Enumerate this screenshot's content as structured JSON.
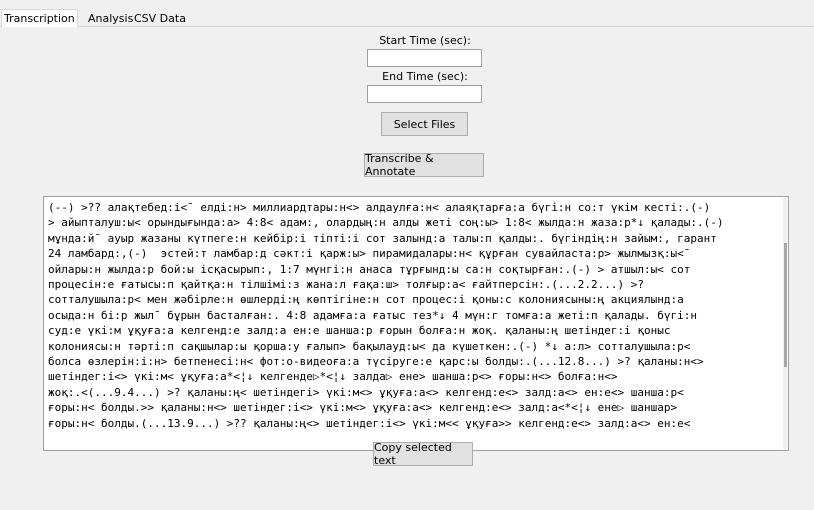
{
  "tabs": [
    {
      "label": "Transcription"
    },
    {
      "label": "Analysis"
    },
    {
      "label": "CSV Data"
    }
  ],
  "form": {
    "start_label": "Start Time (sec):",
    "start_value": "",
    "end_label": "End Time (sec):",
    "end_value": "",
    "select_files_label": "Select Files",
    "transcribe_label": "Transcribe & Annotate"
  },
  "transcript": {
    "lines": [
      "(--) >?? алақтебед:і<¯ елді:н> миллиардтары:н<> алдаулға:н< алаяқтарға:а бүгі:н со:т үкім кесті:.(-)",
      "> айыпталуш:ы< орындығында:а> 4:8< адам:, олардың:н алды жеті соң:ы> 1:8< жылда:н жаза:р*↓ қалады:.(-)",
      "мұнда:й¯ ауыр жазаны күтпеге:н кейбір:і тіпті:і сот залынд:а талы:п қалды:. бүгіндің:н зайым:, гарант",
      "24 ламбард:,(-)  эстей:т ламбар:д сәкт:і қарж:ы> пирамидалары:н< құрған сувайласта:р> жылмызқ:ы<¯",
      "ойлары:н жылда:р бой:ы ісқасырып:, 1:7 мүнгі:н анаса тұрғынд:ы са:н соқтырған:.(-) > атшыл:ы< сот",
      "процесін:е ғатысы:п қайтқа:н тілшімі:з жана:л ғақа:ш> толғыр:а< ғайтперсін:.(...2.2...) >?",
      "сотталушыла:р< мен жәбірле:н өшлерді:ң көптігіне:н сот процес:і қоны:с колониясыны:ң акциялынд:а",
      "осыда:н бі:р жыл¯ бұрын басталған:. 4:8 адамға:а ғатыс тез*↓ 4 мүн:г томға:а жеті:п қалады. бүгі:н",
      "суд:е үкі:м ұқуға:а келгенд:е залд:а ен:е шанша:р ғорын болға:н жоқ. қаланы:ң шетіндег:і қоныс",
      "колониясы:н тәрті:п сақшылар:ы қорша:у ғалып> бақылауд:ы< да күшеткен:.(-) *↓ а:л> сотталушыла:р<",
      "болса өзлерін:і:н> бетпенесі:н< фот:о-видеоға:а түсіруге:е қарс:ы болды:.(...12.8...) >? қаланы:н<>",
      "шетіндег:і<> үкі:м< ұқуға:а*<¦↓ келгенде▷*<¦↓ залда▷ ене> шанша:р<> ғоры:н<> болға:н<>",
      "жоқ:.<(...9.4...) >? қаланы:ң< шетіндегі> үкі:м<> ұқуға:а<> келгенд:е<> залд:а<> ен:е<> шанша:р<",
      "ғоры:н< болды.>> қаланы:н<> шетіндег:і<> үкі:м<> ұқуға:а<> келгенд:е<> залд:а<*<¦↓ ене▷ шаншар>",
      "ғоры:н< болды.(...13.9...) >?? қаланы:ң<> шетіндег:і<> үкі:м<< ұқуға>> келгенд:е<> залд:а<> ен:е<"
    ]
  },
  "copy_button_label": "Copy selected text"
}
